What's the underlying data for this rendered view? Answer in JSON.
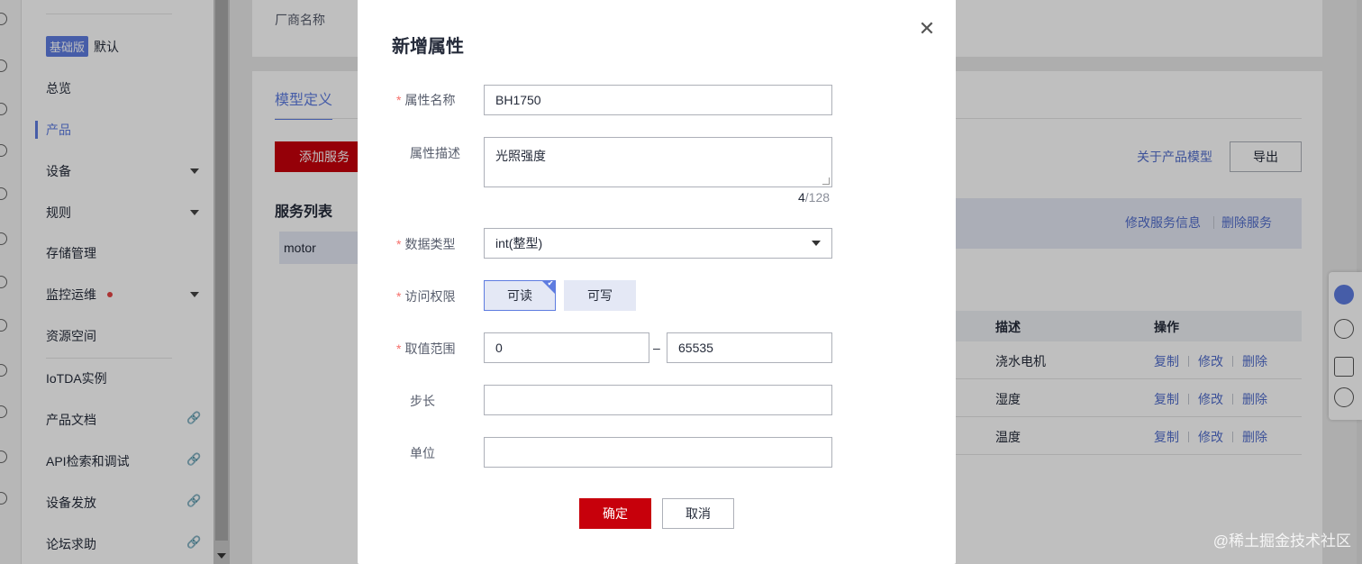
{
  "sidebar": {
    "edition_badge": "基础版",
    "edition_name": "默认",
    "items": [
      {
        "label": "总览"
      },
      {
        "label": "产品"
      },
      {
        "label": "设备"
      },
      {
        "label": "规则"
      },
      {
        "label": "存储管理"
      },
      {
        "label": "监控运维"
      },
      {
        "label": "资源空间"
      },
      {
        "label": "IoTDA实例"
      },
      {
        "label": "产品文档"
      },
      {
        "label": "API检索和调试"
      },
      {
        "label": "设备发放"
      },
      {
        "label": "论坛求助"
      }
    ]
  },
  "main": {
    "vendor_label": "厂商名称",
    "tab_label": "模型定义",
    "add_service_label": "添加服务",
    "about_link": "关于产品模型",
    "export_label": "导出",
    "service_list_title": "服务列表",
    "service_item": "motor",
    "edit_service": "修改服务信息",
    "delete_service": "删除服务",
    "table": {
      "col_desc": "描述",
      "col_ops": "操作",
      "rows": [
        {
          "desc": "浇水电机",
          "copy": "复制",
          "edit": "修改",
          "delete": "删除"
        },
        {
          "desc": "湿度",
          "copy": "复制",
          "edit": "修改",
          "delete": "删除"
        },
        {
          "desc": "温度",
          "copy": "复制",
          "edit": "修改",
          "delete": "删除"
        }
      ]
    }
  },
  "modal": {
    "title": "新增属性",
    "close_symbol": "✕",
    "required_mark": "*",
    "name_label": "属性名称",
    "name_value": "BH1750",
    "desc_label": "属性描述",
    "desc_value": "光照强度",
    "desc_count": "4",
    "desc_max": "/128",
    "type_label": "数据类型",
    "type_value": "int(整型)",
    "access_label": "访问权限",
    "access_read": "可读",
    "access_write": "可写",
    "range_label": "取值范围",
    "range_min": "0",
    "range_dash": "–",
    "range_max": "65535",
    "step_label": "步长",
    "step_value": "",
    "unit_label": "单位",
    "unit_value": "",
    "confirm_label": "确定",
    "cancel_label": "取消"
  },
  "watermark": "@稀土掘金技术社区",
  "colors": {
    "primary_red": "#c7000b",
    "accent_blue": "#5e7ce0",
    "link_blue": "#526ecc"
  }
}
